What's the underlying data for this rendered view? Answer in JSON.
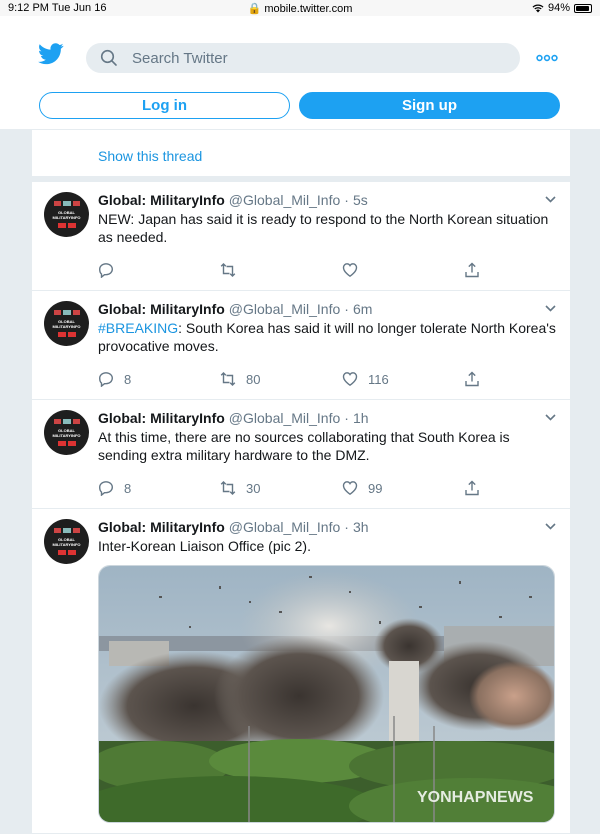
{
  "status": {
    "time": "9:12 PM  Tue Jun 16",
    "url": "mobile.twitter.com",
    "battery": "94%",
    "battery_level": 0.94
  },
  "header": {
    "search_placeholder": "Search Twitter",
    "login_label": "Log in",
    "signup_label": "Sign up"
  },
  "thread": {
    "show_label": "Show this thread"
  },
  "avatar_text": "GLOBAL MILITARYINFO",
  "tweets": [
    {
      "name": "Global: MilitaryInfo",
      "handle": "@Global_Mil_Info",
      "sep": "·",
      "time": "5s",
      "text": "NEW: Japan has said it is ready to respond to the North Korean situation as needed.",
      "replies": "",
      "retweets": "",
      "likes": ""
    },
    {
      "name": "Global: MilitaryInfo",
      "handle": "@Global_Mil_Info",
      "sep": "·",
      "time": "6m",
      "hashtag": "#BREAKING",
      "text": ": South Korea has said it will no longer tolerate North Korea's provocative moves.",
      "replies": "8",
      "retweets": "80",
      "likes": "116"
    },
    {
      "name": "Global: MilitaryInfo",
      "handle": "@Global_Mil_Info",
      "sep": "·",
      "time": "1h",
      "text": "At this time, there are no sources collaborating that South Korea is sending extra military hardware to the DMZ.",
      "replies": "8",
      "retweets": "30",
      "likes": "99"
    },
    {
      "name": "Global: MilitaryInfo",
      "handle": "@Global_Mil_Info",
      "sep": "·",
      "time": "3h",
      "text": "Inter-Korean Liaison Office (pic 2).",
      "watermark": "YONHAPNEWS"
    }
  ],
  "colors": {
    "brand": "#1da1f2",
    "link": "#1b95e0",
    "muted": "#657786",
    "background": "#e6ecf0"
  }
}
